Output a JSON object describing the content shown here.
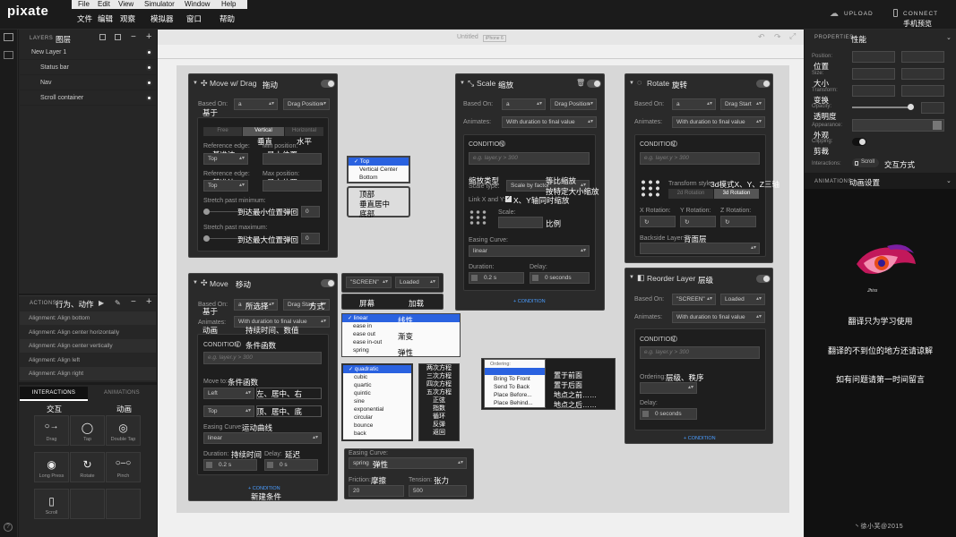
{
  "app": {
    "logo": "pixate"
  },
  "menubar": [
    "File",
    "Edit",
    "View",
    "Simulator",
    "Window",
    "Help"
  ],
  "menubar_cn": [
    "文件",
    "编辑",
    "观察",
    "模拟器",
    "窗口",
    "帮助"
  ],
  "top_right": {
    "upload": "UPLOAD",
    "connect": "CONNECT",
    "connect_cn": "手机预览"
  },
  "layers": {
    "header": "LAYERS",
    "header_cn": "图层",
    "items": [
      "New Layer 1",
      "Status bar",
      "Nav",
      "Scroll container"
    ]
  },
  "actions": {
    "header": "ACTIONS",
    "header_cn": "行为、动作",
    "items": [
      "Alignment: Align bottom",
      "Alignment: Align center horizontally",
      "Alignment: Align center vertically",
      "Alignment: Align left",
      "Alignment: Align right"
    ]
  },
  "tabs": {
    "interactions": "INTERACTIONS",
    "animations": "ANIMATIONS",
    "interactions_cn": "交互",
    "animations_cn": "动画"
  },
  "gestures": [
    "Drag",
    "Tap",
    "Double Tap",
    "Long Press",
    "Rotate",
    "Pinch",
    "Scroll"
  ],
  "canvas": {
    "title": "Untitled",
    "device": "iPhone 6"
  },
  "move_drag": {
    "title": "Move w/ Drag",
    "title_cn": "拖动",
    "based_on": "Based On:",
    "based_on_cn": "基于",
    "based_val": "a",
    "based_val2": "Drag Position",
    "seg": [
      "Free",
      "Vertical",
      "Horizontal"
    ],
    "seg_cn": [
      "垂直",
      "水平"
    ],
    "ref_edge": "Reference edge:",
    "ref_edge_cn": "基准边",
    "min_pos": "Min position:",
    "min_pos_cn": "最小位置",
    "top": "Top",
    "max_pos": "Max position:",
    "max_pos_cn": "最大位置",
    "stretch_min": "Stretch past minimum:",
    "stretch_min_cn": "到达最小位置弹回",
    "stretch_max": "Stretch past maximum:",
    "stretch_max_cn": "到达最大位置弹回",
    "zero": "0"
  },
  "edge_popup": {
    "items": [
      "Top",
      "Vertical Center",
      "Bottom"
    ],
    "items_cn": [
      "顶部",
      "垂直居中",
      "底部"
    ]
  },
  "move": {
    "title": "Move",
    "title_cn": "移动",
    "based_on": "Based On:",
    "based_on_cn": "基于",
    "based_val": "a",
    "based_val_cn": "所选择",
    "based_val2": "Drag Start",
    "based_val2_cn": "方式",
    "animates": "Animates:",
    "animates_cn": "动画",
    "animates_val": "With duration to final value",
    "animates_val_cn": "持续时间、数值",
    "condition": "CONDITION",
    "condition_cn": "条件函数",
    "placeholder": "e.g. layer.y > 300",
    "move_to": "Move to:",
    "move_to_cn": "条件函数",
    "left": "Left",
    "left_cn": "左、居中、右",
    "top": "Top",
    "top_cn": "顶、居中、底",
    "easing": "Easing Curve:",
    "easing_cn": "运动曲线",
    "linear": "linear",
    "duration": "Duration:",
    "duration_cn": "持续时间",
    "duration_val": "0.2 s",
    "delay": "Delay:",
    "delay_cn": "延迟",
    "delay_val": "0 s",
    "add": "+ CONDITION",
    "add_cn": "新建条件"
  },
  "screen_loaded": {
    "screen": "\"SCREEN\"",
    "loaded": "Loaded",
    "screen_cn": "屏幕",
    "loaded_cn": "加载"
  },
  "ease_popup": {
    "items": [
      "linear",
      "ease in",
      "ease out",
      "ease in-out",
      "spring"
    ],
    "items_cn": [
      "线性",
      "渐变",
      "弹性"
    ]
  },
  "quad_popup": {
    "items": [
      "quadratic",
      "cubic",
      "quartic",
      "quintic",
      "sine",
      "exponential",
      "circular",
      "bounce",
      "back"
    ],
    "items_cn": [
      "两次方程",
      "三次方程",
      "四次方程",
      "五次方程",
      "正弦",
      "指数",
      "循环",
      "反弹",
      "返回"
    ]
  },
  "order_popup": {
    "title": "Ordering:",
    "items": [
      "Bring To Front",
      "Send To Back",
      "Place Before...",
      "Place Behind..."
    ],
    "items_cn": [
      "置于前面",
      "置于后面",
      "地点之前……",
      "地点之后……"
    ]
  },
  "spring": {
    "label": "Easing Curve:",
    "val": "spring",
    "val_cn": "弹性",
    "friction": "Friction:",
    "friction_cn": "摩擦",
    "tension": "Tension:",
    "tension_cn": "张力",
    "friction_val": "20",
    "tension_val": "500"
  },
  "scale": {
    "title": "Scale",
    "title_cn": "缩放",
    "based_on": "Based On:",
    "based_val": "a",
    "based_val2": "Drag Position",
    "animates": "Animates:",
    "animates_val": "With duration to final value",
    "condition": "CONDITION",
    "placeholder": "e.g. layer.y > 300",
    "scale_type": "Scale type:",
    "scale_type_cn": "缩放类型",
    "scale_val": "Scale by factor",
    "scale_val_cn": "等比缩放",
    "scale_val_cn2": "按特定大小缩放",
    "link": "Link X and Y:",
    "link_cn": "X、Y轴同时缩放",
    "scale": "Scale:",
    "scale_cn": "比例",
    "easing": "Easing Curve:",
    "linear": "linear",
    "duration": "Duration:",
    "duration_val": "0.2 s",
    "delay": "Delay:",
    "delay_val": "0 seconds",
    "add": "+ CONDITION"
  },
  "rotate": {
    "title": "Rotate",
    "title_cn": "旋转",
    "based_on": "Based On:",
    "based_val": "a",
    "based_val2": "Drag Start",
    "animates": "Animates:",
    "animates_val": "With duration to final value",
    "condition": "CONDITION",
    "placeholder": "e.g. layer.y > 300",
    "tstyle": "Transform style:",
    "tstyle_cn": "3d模式X、Y、Z三轴",
    "t2d": "2d Rotation",
    "t3d": "3d Rotation",
    "xr": "X Rotation:",
    "yr": "Y Rotation:",
    "zr": "Z Rotation:",
    "backside": "Backside Layer:",
    "backside_cn": "背面层"
  },
  "reorder": {
    "title": "Reorder Layer",
    "title_cn": "层级",
    "based_on": "Based On:",
    "based_val": "\"SCREEN\"",
    "based_val2": "Loaded",
    "animates": "Animates:",
    "animates_val": "With duration to final value",
    "condition": "CONDITION",
    "placeholder": "e.g. layer.y > 300",
    "ordering": "Ordering:",
    "ordering_cn": "层级、秩序",
    "delay": "Delay:",
    "delay_val": "0 seconds",
    "add": "+ CONDITION"
  },
  "properties": {
    "header": "PROPERTIES",
    "header_cn": "性能",
    "position": "Position:",
    "position_cn": "位置",
    "size": "Size:",
    "size_cn": "大小",
    "transform": "Transform:",
    "transform_cn": "变换",
    "opacity": "Opacity:",
    "opacity_cn": "透明度",
    "appearance": "Appearance:",
    "appearance_cn": "外观",
    "clipping": "Clipping:",
    "clipping_cn": "剪裁",
    "interactions": "Interactions:",
    "scroll": "Scroll",
    "interactions_cn": "交互方式",
    "anim_header": "ANIMATIONS",
    "anim_header_cn": "动画设置"
  },
  "notes": {
    "brand": "Jhiss",
    "l1": "翻译只为学习使用",
    "l2": "翻译的不到位的地方还请谅解",
    "l3": "如有问题请第一时间留言",
    "sig": "丶徐小芙@2015"
  }
}
